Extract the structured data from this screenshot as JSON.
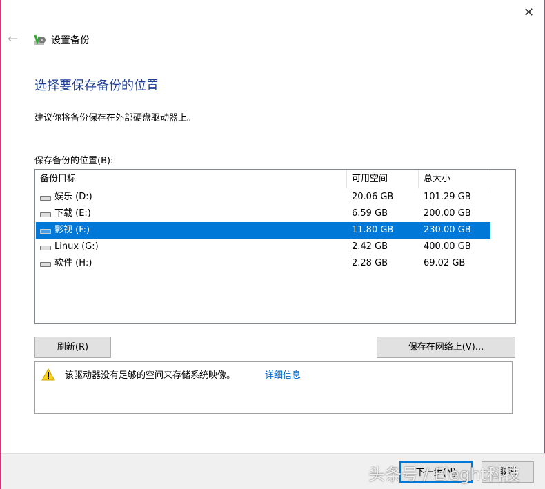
{
  "window": {
    "title": "设置备份",
    "close": "✕",
    "back": "←"
  },
  "heading": "选择要保存备份的位置",
  "description": "建议你将备份保存在外部硬盘驱动器上。",
  "location_label": "保存备份的位置(B):",
  "table": {
    "headers": [
      "备份目标",
      "可用空间",
      "总大小"
    ],
    "rows": [
      {
        "name": "娱乐 (D:)",
        "free": "20.06 GB",
        "total": "101.29 GB",
        "selected": false
      },
      {
        "name": "下载 (E:)",
        "free": "6.59 GB",
        "total": "200.00 GB",
        "selected": false
      },
      {
        "name": "影视 (F:)",
        "free": "11.80 GB",
        "total": "230.00 GB",
        "selected": true
      },
      {
        "name": "Linux (G:)",
        "free": "2.42 GB",
        "total": "400.00 GB",
        "selected": false
      },
      {
        "name": "软件 (H:)",
        "free": "2.28 GB",
        "total": "69.02 GB",
        "selected": false
      }
    ]
  },
  "buttons": {
    "refresh": "刷新(R)",
    "save_network": "保存在网络上(V)...",
    "next": "下一步(N)",
    "cancel": "取消"
  },
  "warning": {
    "text": "该驱动器没有足够的空间来存储系统映像。",
    "link": "详细信息"
  },
  "watermark": "头条号 / Eleght科技"
}
